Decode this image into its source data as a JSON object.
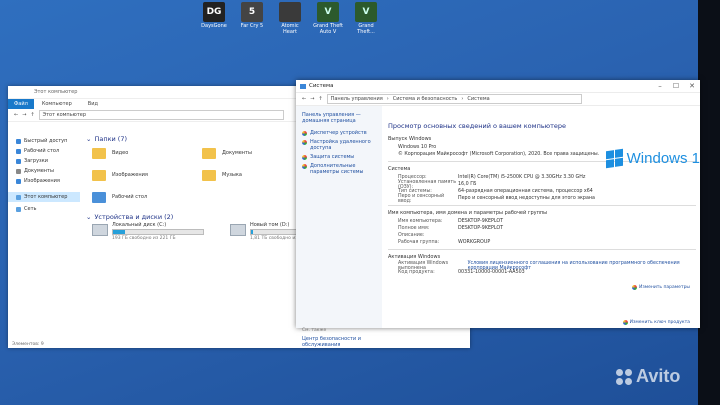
{
  "desktop": {
    "icons": [
      {
        "label": "DaysGone",
        "glyph": "DG",
        "color": "#222222"
      },
      {
        "label": "Far Cry 5",
        "glyph": "5",
        "color": "#444444"
      },
      {
        "label": "Atomic Heart",
        "glyph": "",
        "color": "#3a3a3a"
      },
      {
        "label": "Grand Theft Auto V",
        "glyph": "V",
        "color": "#2c5a2c"
      },
      {
        "label": "Grand Theft...",
        "glyph": "V",
        "color": "#2c5a2c"
      }
    ]
  },
  "explorer": {
    "title": "Этот компьютер",
    "ribbon": {
      "file": "Файл",
      "computer": "Компьютер",
      "view": "Вид"
    },
    "address": "Этот компьютер",
    "nav": [
      {
        "label": "Быстрый доступ",
        "icon": "star-icon",
        "color": "#3a86d8"
      },
      {
        "label": "Рабочий стол",
        "icon": "desktop-icon",
        "color": "#3a86d8"
      },
      {
        "label": "Загрузки",
        "icon": "download-icon",
        "color": "#3a86d8"
      },
      {
        "label": "Документы",
        "icon": "documents-icon",
        "color": "#888888"
      },
      {
        "label": "Изображения",
        "icon": "pictures-icon",
        "color": "#3a86d8"
      },
      {
        "label": "Этот компьютер",
        "icon": "computer-icon",
        "color": "#5aa0e0",
        "selected": true
      },
      {
        "label": "Сеть",
        "icon": "network-icon",
        "color": "#5aa0e0"
      }
    ],
    "folders_header": "Папки (7)",
    "folders": [
      "Видео",
      "Документы",
      "Изображения",
      "Музыка",
      "Рабочий стол"
    ],
    "drives_header": "Устройства и диски (2)",
    "drives": [
      {
        "name": "Локальный диск (C:)",
        "free": "193 ГБ свободно из 221 ГБ",
        "used_fraction": 0.13
      },
      {
        "name": "Новый том (D:)",
        "free": "1,81 ТБ свободно из 465 ГБ",
        "used_fraction": 0.02
      }
    ],
    "status": "Элементов: 9"
  },
  "system": {
    "title": "Система",
    "address": [
      "Панель управления",
      "Система и безопасность",
      "Система"
    ],
    "side_home": "Панель управления — домашняя страница",
    "side_links": [
      "Диспетчер устройств",
      "Настройка удаленного доступа",
      "Защита системы",
      "Дополнительные параметры системы"
    ],
    "see_also": "См. также",
    "see_also_link": "Центр безопасности и обслуживания",
    "page_title": "Просмотр основных сведений о вашем компьютере",
    "edition_header": "Выпуск Windows",
    "edition": "Windows 10 Pro",
    "copyright": "© Корпорация Майкрософт (Microsoft Corporation), 2020. Все права защищены.",
    "windows_logo_text": "Windows 1",
    "system_header": "Система",
    "system_rows": [
      {
        "k": "Процессор:",
        "v": "Intel(R) Core(TM) i5-2500K CPU @ 3.30GHz   3.30 GHz"
      },
      {
        "k": "Установленная память (ОЗУ):",
        "v": "16,0 ГБ"
      },
      {
        "k": "Тип системы:",
        "v": "64-разрядная операционная система, процессор x64"
      },
      {
        "k": "Перо и сенсорный ввод:",
        "v": "Перо и сенсорный ввод недоступны для этого экрана"
      }
    ],
    "name_header": "Имя компьютера, имя домена и параметры рабочей группы",
    "name_rows": [
      {
        "k": "Имя компьютера:",
        "v": "DESKTOP-9KEPLOT"
      },
      {
        "k": "Полное имя:",
        "v": "DESKTOP-9KEPLOT"
      },
      {
        "k": "Описание:",
        "v": ""
      },
      {
        "k": "Рабочая группа:",
        "v": "WORKGROUP"
      }
    ],
    "change_params": "Изменить параметры",
    "activation_header": "Активация Windows",
    "activation_row": {
      "k": "Активация Windows выполнена",
      "v": "Условия лицензионного соглашения на использование программного обеспечения корпорации Майкрософт"
    },
    "product_row": {
      "k": "Код продукта:",
      "v": "00331-10000-00001-AA503"
    },
    "change_key": "Изменить ключ продукта"
  },
  "watermark": "Avito"
}
